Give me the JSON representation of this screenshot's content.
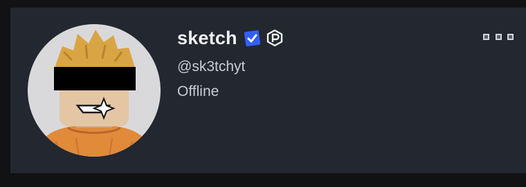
{
  "profile": {
    "display_name": "sketch",
    "username": "@sk3tchyt",
    "status": "Offline",
    "icons": {
      "avatar": "avatar-headshot",
      "verified": "verified-check-badge",
      "premium": "premium-icon",
      "more": "more-options-icon"
    },
    "colors": {
      "card_background": "#232730",
      "page_background": "#121215",
      "verified_blue": "#335fff",
      "text_primary": "#f2f3f5",
      "text_secondary": "#c9ccd3"
    }
  }
}
